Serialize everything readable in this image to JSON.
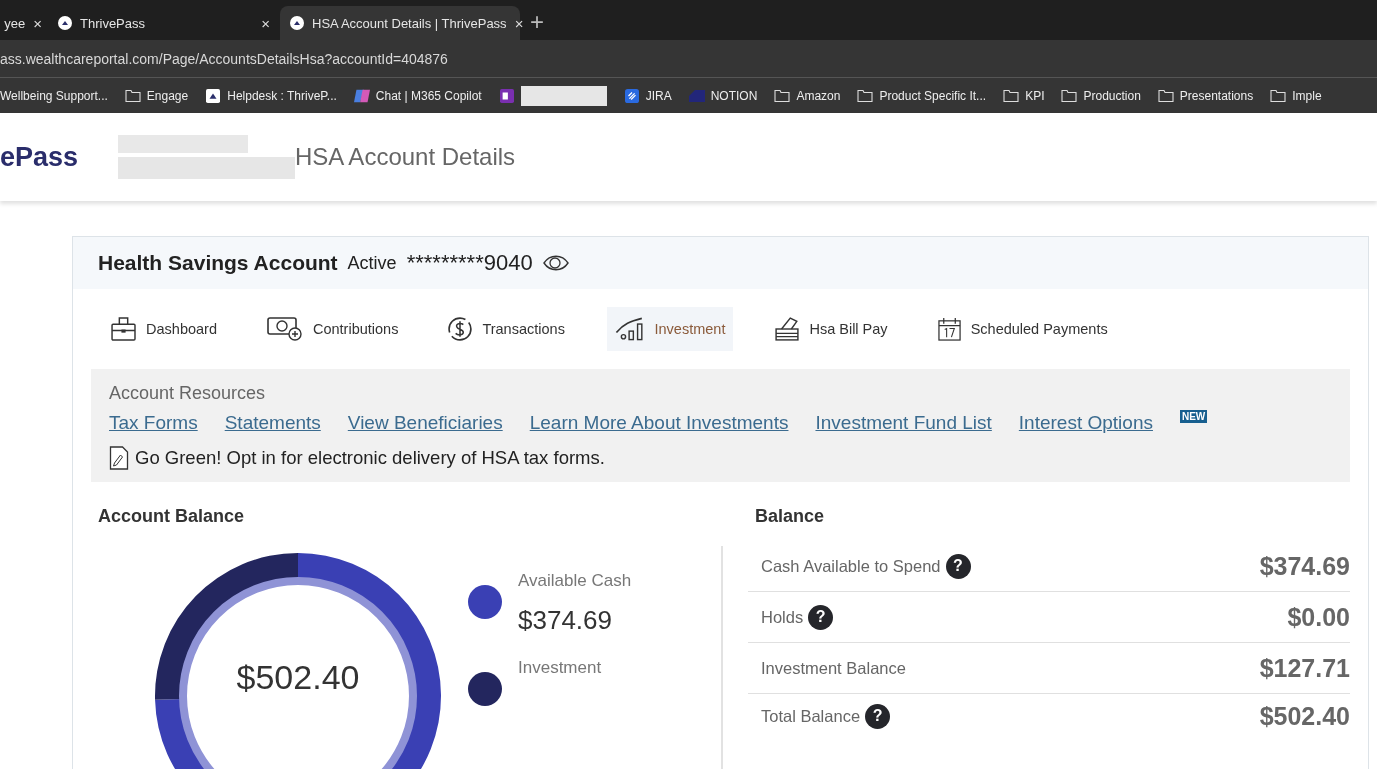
{
  "browser": {
    "tabs": [
      {
        "title": "yee",
        "close": "×",
        "selected": false
      },
      {
        "title": "ThrivePass",
        "close": "×",
        "selected": false
      },
      {
        "title": "HSA Account Details | ThrivePass",
        "close": "×",
        "selected": true
      }
    ],
    "new_tab": "+",
    "address": "ass.wealthcareportal.com/Page/AccountsDetailsHsa?accountId=404876",
    "bookmarks": [
      {
        "label": "Wellbeing Support...",
        "kind": "none"
      },
      {
        "label": "Engage",
        "kind": "folder"
      },
      {
        "label": "Helpdesk : ThriveP...",
        "kind": "site"
      },
      {
        "label": "Chat | M365 Copilot",
        "kind": "copilot"
      },
      {
        "kind": "redacted"
      },
      {
        "label": "JIRA",
        "kind": "jira"
      },
      {
        "label": "NOTION",
        "kind": "notion"
      },
      {
        "label": "Amazon",
        "kind": "folder"
      },
      {
        "label": "Product Specific It...",
        "kind": "folder"
      },
      {
        "label": "KPI",
        "kind": "folder"
      },
      {
        "label": "Production",
        "kind": "folder"
      },
      {
        "label": "Presentations",
        "kind": "folder"
      },
      {
        "label": "Imple",
        "kind": "folder"
      }
    ]
  },
  "header": {
    "logo": "ePass",
    "page_title": "HSA Account Details"
  },
  "account": {
    "name": "Health Savings Account",
    "status": "Active",
    "number": "*********9040"
  },
  "nav": [
    {
      "label": "Dashboard",
      "selected": false
    },
    {
      "label": "Contributions",
      "selected": false
    },
    {
      "label": "Transactions",
      "selected": false
    },
    {
      "label": "Investment",
      "selected": true
    },
    {
      "label": "Hsa Bill Pay",
      "selected": false
    },
    {
      "label": "Scheduled Payments",
      "selected": false
    }
  ],
  "resources": {
    "title": "Account Resources",
    "links": [
      "Tax Forms",
      "Statements",
      "View Beneficiaries",
      "Learn More About Investments",
      "Investment Fund List",
      "Interest Options"
    ],
    "badge": "NEW",
    "notice": "Go Green! Opt in for electronic delivery of HSA tax forms."
  },
  "account_balance": {
    "title": "Account Balance",
    "total": "$502.40",
    "chart_data": {
      "type": "donut",
      "categories": [
        "Available Cash",
        "Investment"
      ],
      "values": [
        74.58,
        25.42
      ]
    },
    "legend": [
      {
        "value": "$374.69",
        "color": "#3a40b4"
      },
      {
        "color": "#23265e"
      }
    ]
  },
  "balance": {
    "title": "Balance",
    "rows": [
      {
        "label": "Cash Available to Spend",
        "help": "?",
        "value": "$374.69"
      },
      {
        "label": "Holds",
        "help": "?",
        "value": "$0.00"
      },
      {
        "label": "Investment Balance",
        "value": "$127.71"
      },
      {
        "label": "Total Balance",
        "help": "?",
        "value": "$502.40"
      }
    ]
  }
}
